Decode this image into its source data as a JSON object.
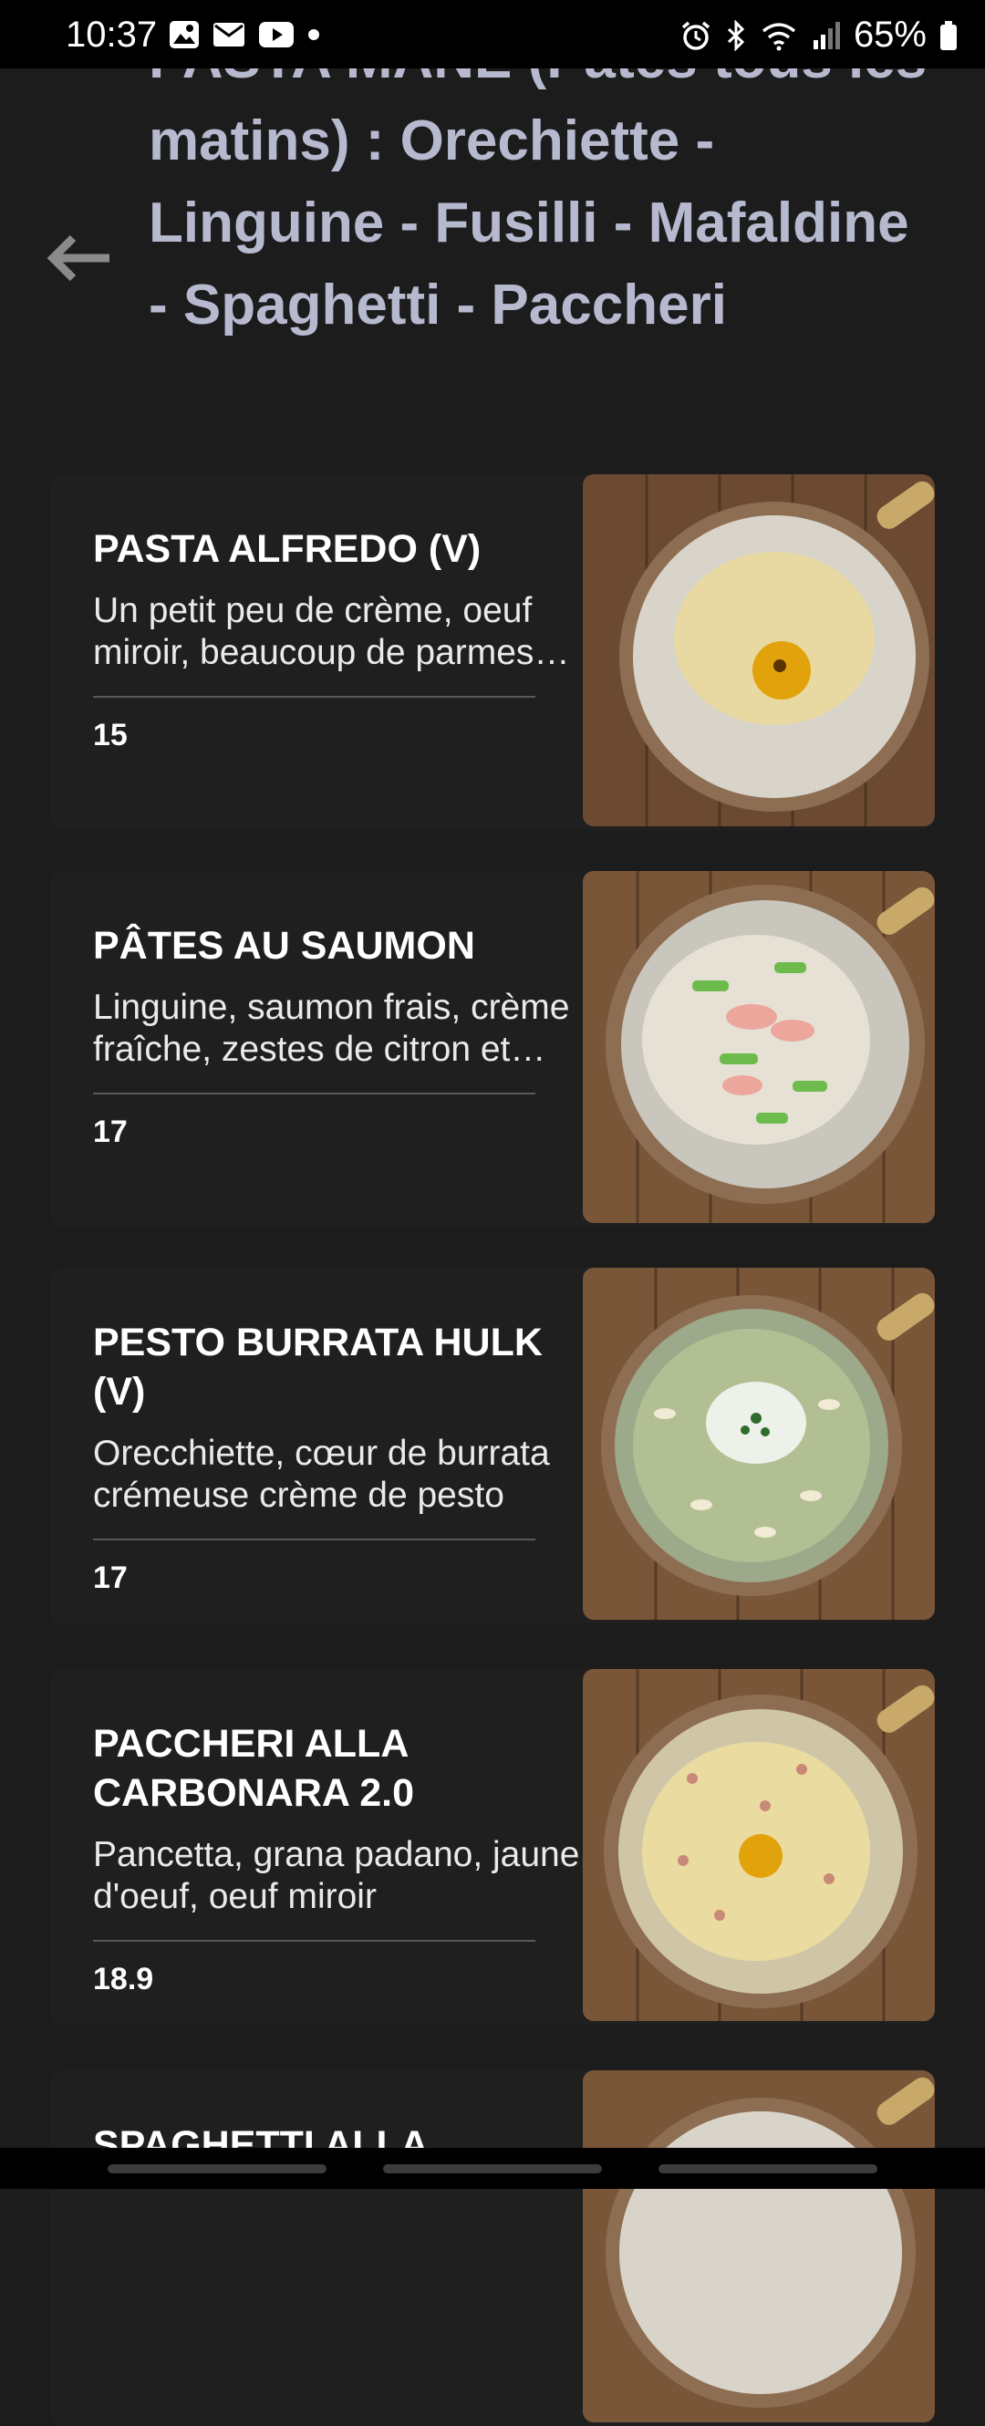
{
  "status_bar": {
    "time": "10:37",
    "battery": "65%",
    "left_icons": [
      "gallery-icon",
      "mail-icon",
      "youtube-icon",
      "dot-icon"
    ],
    "right_icons": [
      "alarm-icon",
      "bluetooth-icon",
      "wifi-icon",
      "signal-icon",
      "battery-icon"
    ]
  },
  "header": {
    "title": "PASTA MANE (Pâtes tous les matins) : Orechiette - Linguine - Fusilli - Mafaldine - Spaghetti - Paccheri",
    "back_icon": "back-arrow-icon"
  },
  "menu": {
    "items": [
      {
        "title": "PASTA ALFREDO (V)",
        "desc": "Un petit peu de crème, oeuf miroir, beaucoup de parmesan et de poivre",
        "price": "15"
      },
      {
        "title": "PÂTES AU SAUMON",
        "desc": "Linguine, saumon frais, crème fraîche, zestes de citron et ciboulette",
        "price": "17"
      },
      {
        "title": "PESTO BURRATA HULK (V)",
        "desc": "Orecchiette, cœur de burrata crémeuse crème de pesto",
        "price": "17"
      },
      {
        "title": "PACCHERI ALLA CARBONARA 2.0",
        "desc": "Pancetta, grana padano, jaune d'oeuf, oeuf miroir",
        "price": "18.9"
      },
      {
        "title": "SPAGHETTI ALLA",
        "desc": "",
        "price": ""
      }
    ]
  },
  "colors": {
    "background": "#1c1c1d",
    "card": "#1f1f20",
    "title_lavender": "#b7b9cf",
    "copper_pan": "#8e6e52",
    "wood": "#7a5638"
  }
}
